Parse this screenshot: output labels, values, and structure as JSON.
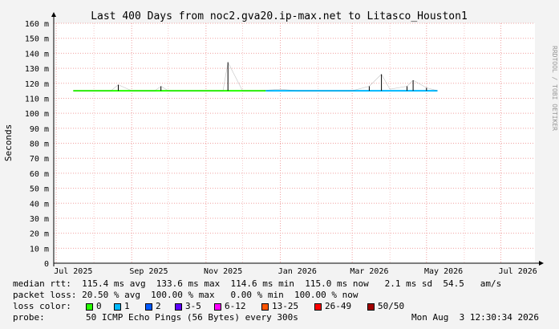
{
  "watermark": "RRDTOOL / TOBI OETIKER",
  "chart_data": {
    "type": "line",
    "title": "Last 400 Days from noc2.gva20.ip-max.net to Litasco_Houston1",
    "ylabel": "Seconds",
    "y_ticks": [
      "0",
      "10 m",
      "20 m",
      "30 m",
      "40 m",
      "50 m",
      "60 m",
      "70 m",
      "80 m",
      "90 m",
      "100 m",
      "110 m",
      "120 m",
      "130 m",
      "140 m",
      "150 m",
      "160 m"
    ],
    "ylim": [
      0,
      0.16
    ],
    "x_ticks": [
      "Jul 2025",
      "Sep 2025",
      "Nov 2025",
      "Jan 2026",
      "Mar 2026",
      "May 2026",
      "Jul 2026"
    ],
    "grid": true,
    "series": [
      {
        "name": "median rtt",
        "x": [
          "2025-07-15",
          "2025-08-01",
          "2025-08-15",
          "2025-08-21",
          "2025-09-01",
          "2025-09-20",
          "2025-09-25",
          "2025-10-01",
          "2025-10-15",
          "2025-11-01",
          "2025-11-15",
          "2025-11-19",
          "2025-12-01",
          "2025-12-15",
          "2026-01-01",
          "2026-01-15",
          "2026-02-01",
          "2026-02-15",
          "2026-03-01",
          "2026-03-15",
          "2026-03-25",
          "2026-04-01",
          "2026-04-15",
          "2026-04-20",
          "2026-05-01",
          "2026-05-10"
        ],
        "y": [
          0.115,
          0.115,
          0.115,
          0.119,
          0.115,
          0.115,
          0.118,
          0.115,
          0.115,
          0.115,
          0.115,
          0.134,
          0.115,
          0.115,
          0.116,
          0.115,
          0.115,
          0.115,
          0.115,
          0.118,
          0.126,
          0.116,
          0.118,
          0.122,
          0.117,
          0.115
        ]
      }
    ],
    "legend_swatches": [
      {
        "label": "0",
        "color": "#26ff00"
      },
      {
        "label": "1",
        "color": "#00b8ff"
      },
      {
        "label": "2",
        "color": "#0059ff"
      },
      {
        "label": "3-5",
        "color": "#5e00ff"
      },
      {
        "label": "6-12",
        "color": "#ff00ff"
      },
      {
        "label": "13-25",
        "color": "#ff5500"
      },
      {
        "label": "26-49",
        "color": "#ff0000"
      },
      {
        "label": "50/50",
        "color": "#a10000"
      }
    ]
  },
  "legend": {
    "median_line": "median rtt:  115.4 ms avg  133.6 ms max  114.6 ms min  115.0 ms now   2.1 ms sd  54.5   am/s",
    "loss_line": "packet loss: 20.50 % avg  100.00 % max   0.00 % min  100.00 % now",
    "loss_color_label": "loss color:",
    "probe_label": "probe:",
    "probe_text": "50 ICMP Echo Pings (56 Bytes) every 300s",
    "timestamp": "Mon Aug  3 12:30:34 2026"
  }
}
